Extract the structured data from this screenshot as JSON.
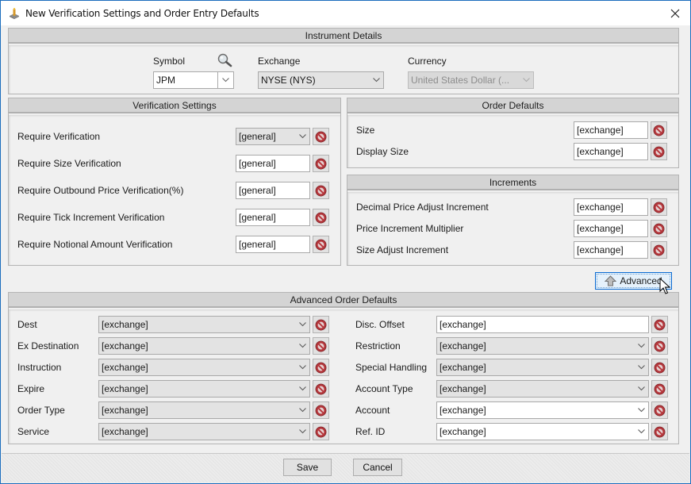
{
  "window": {
    "title": "New Verification Settings and Order Entry Defaults",
    "close_icon": "close-icon"
  },
  "instrument_details": {
    "header": "Instrument Details",
    "symbol_label": "Symbol",
    "symbol_value": "JPM",
    "search_icon": "magnifier-icon",
    "exchange_label": "Exchange",
    "exchange_value": "NYSE (NYS)",
    "currency_label": "Currency",
    "currency_value": "United States Dollar (..."
  },
  "verification_settings": {
    "header": "Verification Settings",
    "rows": [
      {
        "label": "Require Verification",
        "value": "[general]",
        "type": "combo"
      },
      {
        "label": "Require Size Verification",
        "value": "[general]",
        "type": "text"
      },
      {
        "label": "Require Outbound Price Verification(%)",
        "value": "[general]",
        "type": "text"
      },
      {
        "label": "Require Tick Increment Verification",
        "value": "[general]",
        "type": "text"
      },
      {
        "label": "Require Notional Amount Verification",
        "value": "[general]",
        "type": "text"
      }
    ]
  },
  "order_defaults": {
    "header": "Order Defaults",
    "rows": [
      {
        "label": "Size",
        "value": "[exchange]"
      },
      {
        "label": "Display Size",
        "value": "[exchange]"
      }
    ]
  },
  "increments": {
    "header": "Increments",
    "rows": [
      {
        "label": "Decimal Price Adjust Increment",
        "value": "[exchange]"
      },
      {
        "label": "Price Increment Multiplier",
        "value": "[exchange]"
      },
      {
        "label": "Size Adjust Increment",
        "value": "[exchange]"
      }
    ]
  },
  "advanced_button": {
    "label": "Advanced",
    "icon": "arrow-up-icon"
  },
  "advanced_order_defaults": {
    "header": "Advanced Order Defaults",
    "left": [
      {
        "label": "Dest",
        "value": "[exchange]"
      },
      {
        "label": "Ex Destination",
        "value": "[exchange]"
      },
      {
        "label": "Instruction",
        "value": "[exchange]"
      },
      {
        "label": "Expire",
        "value": "[exchange]"
      },
      {
        "label": "Order Type",
        "value": "[exchange]"
      },
      {
        "label": "Service",
        "value": "[exchange]"
      }
    ],
    "right": [
      {
        "label": "Disc. Offset",
        "value": "[exchange]"
      },
      {
        "label": "Restriction",
        "value": "[exchange]"
      },
      {
        "label": "Special Handling",
        "value": "[exchange]"
      },
      {
        "label": "Account Type",
        "value": "[exchange]"
      },
      {
        "label": "Account",
        "value": "[exchange]"
      },
      {
        "label": "Ref. ID",
        "value": "[exchange]"
      }
    ]
  },
  "footer": {
    "save_label": "Save",
    "cancel_label": "Cancel"
  },
  "colors": {
    "accent": "#1c6dbd",
    "clear_icon": "#b5373c",
    "header_bg": "#d4d4d4"
  }
}
